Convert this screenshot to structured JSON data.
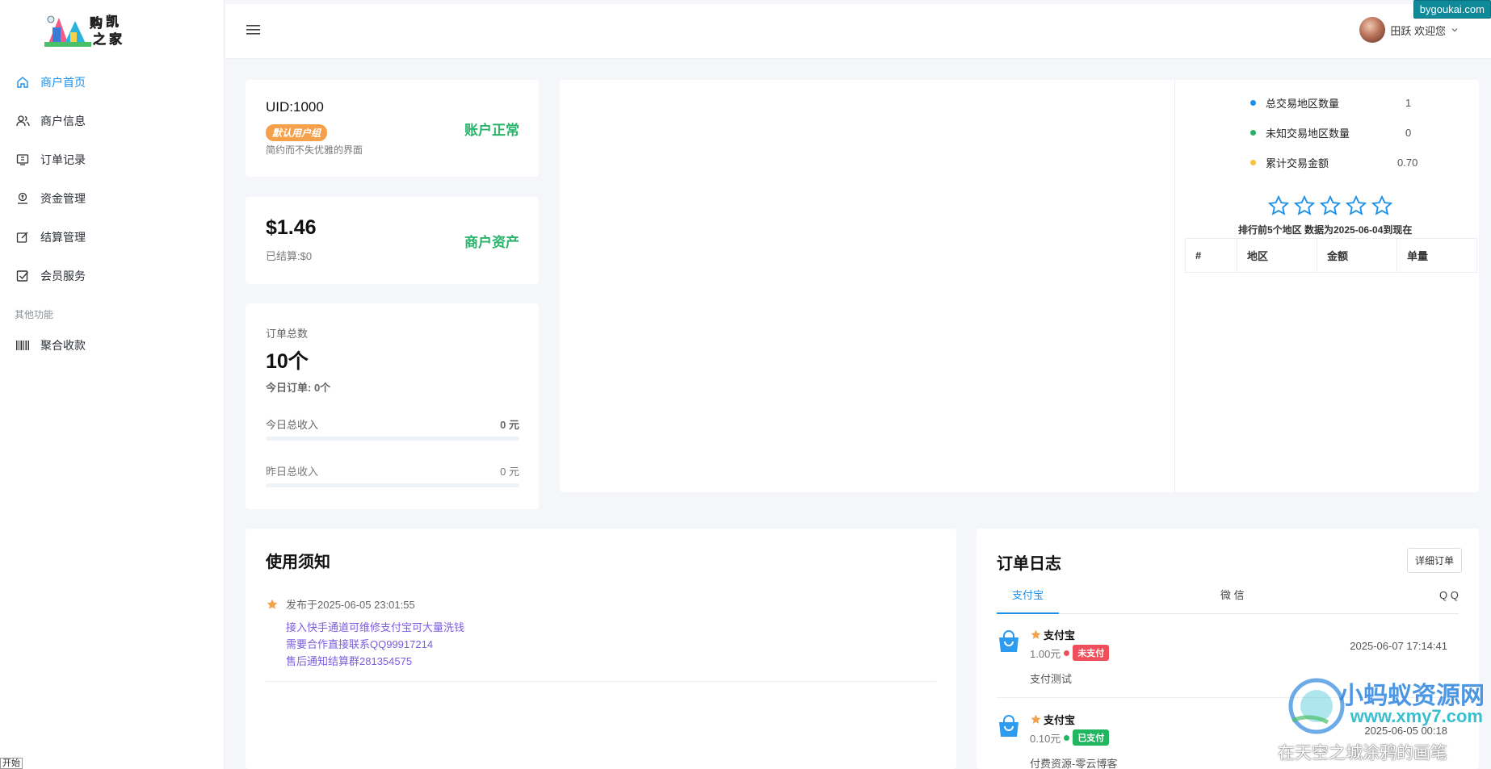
{
  "header": {
    "user_greeting": "田跃 欢迎您",
    "domain": "bygoukai.com"
  },
  "sidebar": {
    "items": [
      {
        "label": "商户首页",
        "icon": "home-icon"
      },
      {
        "label": "商户信息",
        "icon": "users-icon"
      },
      {
        "label": "订单记录",
        "icon": "order-icon"
      },
      {
        "label": "资金管理",
        "icon": "funds-icon"
      },
      {
        "label": "结算管理",
        "icon": "edit-icon"
      },
      {
        "label": "会员服务",
        "icon": "check-icon"
      }
    ],
    "section_label": "其他功能",
    "extra_items": [
      {
        "label": "聚合收款",
        "icon": "barcode-icon"
      }
    ],
    "bottom_tag": "开始"
  },
  "account": {
    "uid": "UID:1000",
    "group": "默认用户组",
    "tagline": "简约而不失优雅的界面",
    "status": "账户正常"
  },
  "assets": {
    "balance": "$1.46",
    "settled": "已结算:$0",
    "label": "商户资产"
  },
  "orders_summary": {
    "total_label": "订单总数",
    "total_value": "10个",
    "today_orders": "今日订单:   0个",
    "today_income_label": "今日总收入",
    "today_income_value": "0 元",
    "yesterday_income_label": "昨日总收入",
    "yesterday_income_value": "0 元"
  },
  "region_stats": {
    "rows": [
      {
        "label": "总交易地区数量",
        "value": "1",
        "color": "#1e90e8"
      },
      {
        "label": "未知交易地区数量",
        "value": "0",
        "color": "#29b36a"
      },
      {
        "label": "累计交易金额",
        "value": "0.70",
        "color": "#f5c242"
      }
    ],
    "stars": 5,
    "note": "排行前5个地区  数据为2025-06-04到现在",
    "table_headers": [
      "#",
      "地区",
      "金额",
      "单量"
    ]
  },
  "notice": {
    "title": "使用须知",
    "date": "发布于2025-06-05 23:01:55",
    "lines": [
      "接入快手通道可维修支付宝可大量洗钱",
      "需要合作直接联系QQ99917214",
      "售后通知结算群281354575"
    ]
  },
  "order_log": {
    "title": "订单日志",
    "detail_button": "详细订单",
    "tabs": [
      "支付宝",
      "微 信",
      "Q Q"
    ],
    "orders": [
      {
        "title": "支付宝",
        "amount": "1.00元",
        "status": "未支付",
        "status_color": "#ef4f5a",
        "time": "2025-06-07 17:14:41",
        "desc": "支付测试"
      },
      {
        "title": "支付宝",
        "amount": "0.10元",
        "status": "已支付",
        "status_color": "#22b660",
        "time": "2025-06-05 00:18",
        "desc": "付费资源-零云博客"
      }
    ]
  },
  "watermark": {
    "brand": "小蚂蚁资源网",
    "url": "www.xmy7.com",
    "footer": "在天空之城涂鸦的画笔"
  }
}
